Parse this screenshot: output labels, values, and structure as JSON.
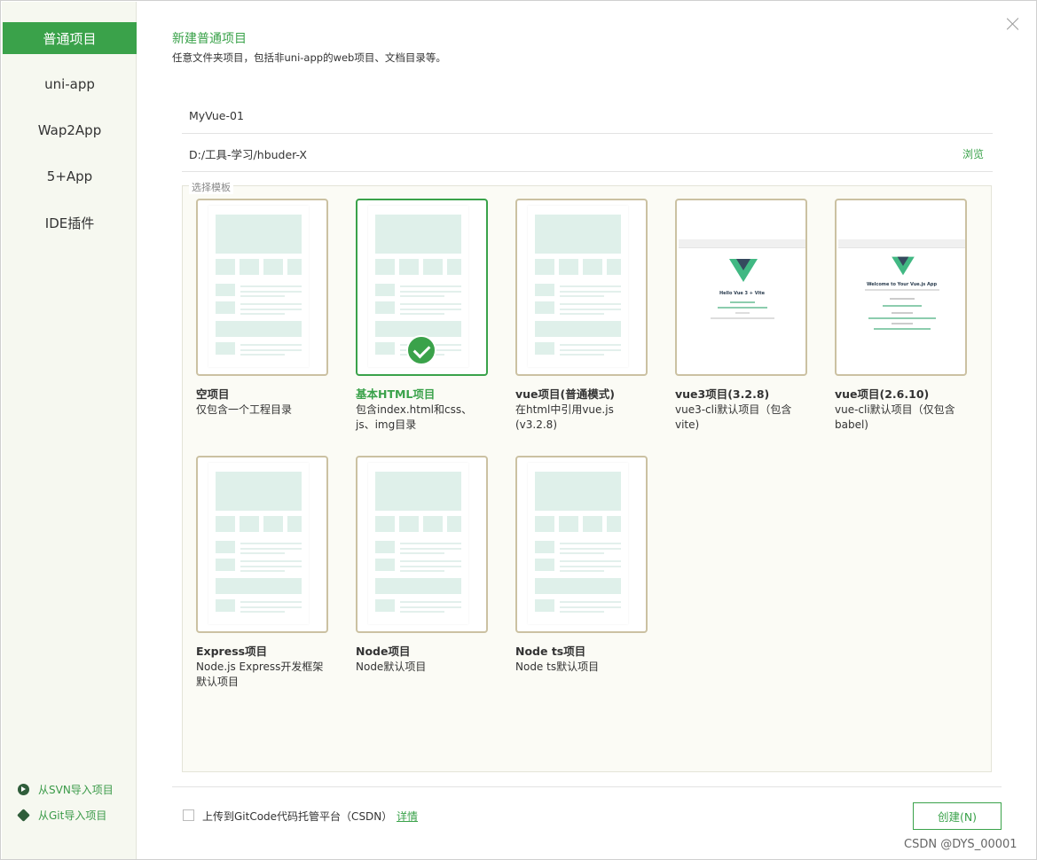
{
  "sidebar": {
    "items": [
      {
        "label": "普通项目",
        "active": true
      },
      {
        "label": "uni-app",
        "active": false
      },
      {
        "label": "Wap2App",
        "active": false
      },
      {
        "label": "5+App",
        "active": false
      },
      {
        "label": "IDE插件",
        "active": false
      }
    ],
    "links": [
      {
        "label": "从SVN导入项目",
        "icon": "svn-icon"
      },
      {
        "label": "从Git导入项目",
        "icon": "git-icon"
      }
    ]
  },
  "header": {
    "title": "新建普通项目",
    "subtitle": "任意文件夹项目，包括非uni-app的web项目、文档目录等。"
  },
  "form": {
    "project_name": "MyVue-01",
    "location": "D:/工具-学习/hbuder-X",
    "browse_label": "浏览"
  },
  "templates": {
    "legend": "选择模板",
    "items": [
      {
        "title": "空项目",
        "desc": "仅包含一个工程目录",
        "selected": false,
        "preview": "layout"
      },
      {
        "title": "基本HTML项目",
        "desc": "包含index.html和css、js、img目录",
        "selected": true,
        "preview": "layout"
      },
      {
        "title": "vue项目(普通模式)",
        "desc": "在html中引用vue.js (v3.2.8)",
        "selected": false,
        "preview": "layout"
      },
      {
        "title": "vue3项目(3.2.8)",
        "desc": "vue3-cli默认项目（包含vite)",
        "selected": false,
        "preview": "vue",
        "screenshot_heading": "Hello Vue 3 + Vite"
      },
      {
        "title": "vue项目(2.6.10)",
        "desc": "vue-cli默认项目（仅包含babel)",
        "selected": false,
        "preview": "vue",
        "screenshot_heading": "Welcome to Your Vue.js App"
      },
      {
        "title": "Express项目",
        "desc": "Node.js Express开发框架默认项目",
        "selected": false,
        "preview": "layout"
      },
      {
        "title": "Node项目",
        "desc": "Node默认项目",
        "selected": false,
        "preview": "layout"
      },
      {
        "title": "Node ts项目",
        "desc": "Node ts默认项目",
        "selected": false,
        "preview": "layout"
      }
    ]
  },
  "footer": {
    "upload_label": "上传到GitCode代码托管平台（CSDN）",
    "upload_checked": false,
    "detail_label": "详情",
    "create_label": "创建(N)"
  },
  "watermark": "CSDN @DYS_00001",
  "colors": {
    "accent": "#3aa24a",
    "card_border": "#cbc1a2",
    "thumb_block": "#dff0ea",
    "sidebar_bg": "#f6f8f0"
  }
}
